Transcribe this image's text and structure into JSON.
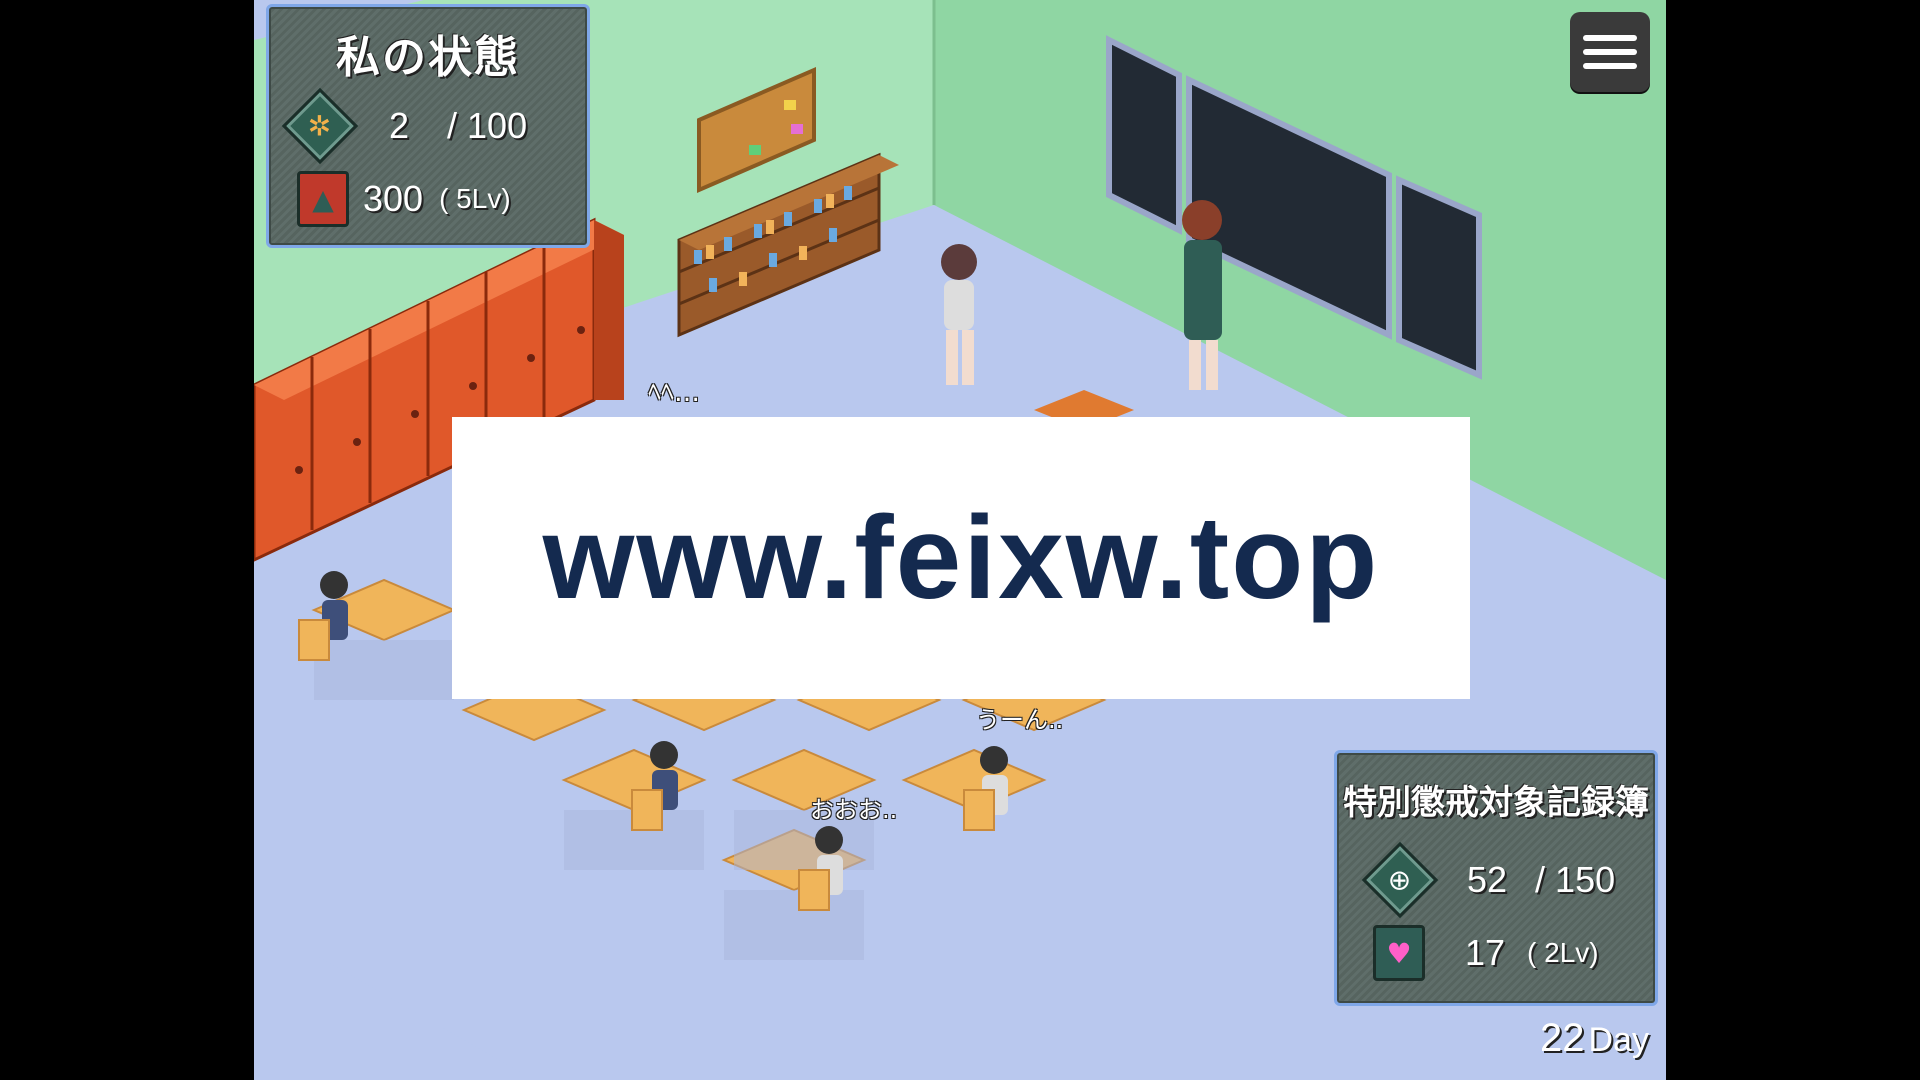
{
  "status_panel": {
    "title": "私の状態",
    "stat1_icon": "cross-diamond-icon",
    "stat1_value": "2",
    "stat1_max": "/ 100",
    "stat2_icon": "red-curtain-icon",
    "stat2_value": "300",
    "stat2_level": "( 5Lv)"
  },
  "record_panel": {
    "title": "特別懲戒対象記録簿",
    "stat1_icon": "target-diamond-icon",
    "stat1_value": "52",
    "stat1_max": "/ 150",
    "stat2_icon": "pink-hearts-icon",
    "stat2_value": "17",
    "stat2_level": "( 2Lv)"
  },
  "day_counter": {
    "value": "22",
    "unit": "Day"
  },
  "watermark": {
    "text": "www.feixw.top"
  },
  "speech_bubbles": {
    "bubble1": "ﾍﾍ…",
    "bubble2": "うーん..",
    "bubble3": "おおお.."
  },
  "colors": {
    "floor": "#b9c8ee",
    "left_wall": "#a6e3b8",
    "right_wall": "#8fd6a3",
    "lockers": "#e0582a",
    "desk": "#f0b55a",
    "panel_border": "#7fa7e8"
  }
}
